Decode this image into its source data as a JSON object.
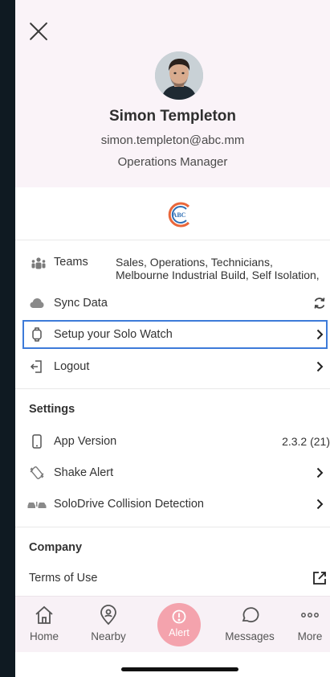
{
  "profile": {
    "name": "Simon Templeton",
    "email": "simon.templeton@abc.mm",
    "role": "Operations Manager"
  },
  "logo": {
    "text": "ABC",
    "colors": [
      "#e9663a",
      "#2f6fb5"
    ]
  },
  "menu": {
    "teams_label": "Teams",
    "teams_line1": "Sales, Operations, Technicians,",
    "teams_line2": "Melbourne Industrial Build, Self Isolation,",
    "sync_label": "Sync Data",
    "watch_label": "Setup your Solo Watch",
    "logout_label": "Logout"
  },
  "settings": {
    "title": "Settings",
    "app_version_label": "App Version",
    "app_version_value": "2.3.2 (21)",
    "shake_alert_label": "Shake Alert",
    "solodrive_label": "SoloDrive Collision Detection"
  },
  "company": {
    "title": "Company",
    "terms_label": "Terms of Use"
  },
  "tabs": {
    "home": "Home",
    "nearby": "Nearby",
    "alert": "Alert",
    "messages": "Messages",
    "more": "More"
  },
  "colors": {
    "header_bg": "#faf3f8",
    "selection_border": "#3d7bd9",
    "alert_bg": "#f4a3ad"
  }
}
